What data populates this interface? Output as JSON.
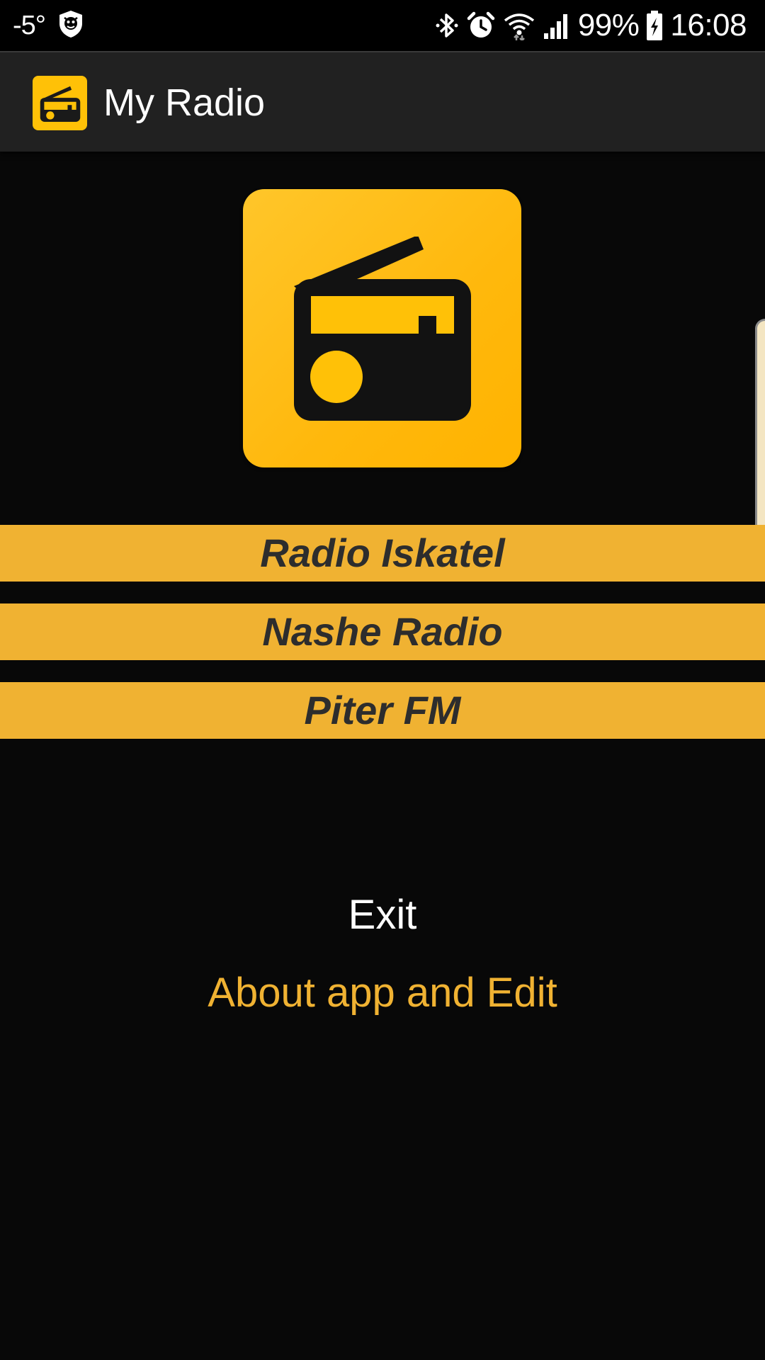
{
  "status_bar": {
    "temperature": "-5°",
    "battery_percent": "99%",
    "clock": "16:08",
    "icons": [
      "weather-app-icon",
      "bluetooth-icon",
      "alarm-icon",
      "wifi-icon",
      "signal-icon",
      "battery-charging-icon"
    ]
  },
  "app_bar": {
    "title": "My Radio",
    "icon": "radio-icon"
  },
  "logo": {
    "icon": "radio-icon",
    "accent_color": "#FFC107"
  },
  "stations": [
    {
      "label": "Radio Iskatel"
    },
    {
      "label": "Nashe Radio"
    },
    {
      "label": "Piter FM"
    }
  ],
  "actions": {
    "exit_label": "Exit",
    "about_label": "About app and Edit"
  },
  "colors": {
    "background": "#080808",
    "app_bar": "#212121",
    "station_button": "#F0B232",
    "station_text": "#2d2d2d",
    "about_text": "#F0B232",
    "exit_text": "#ffffff"
  }
}
